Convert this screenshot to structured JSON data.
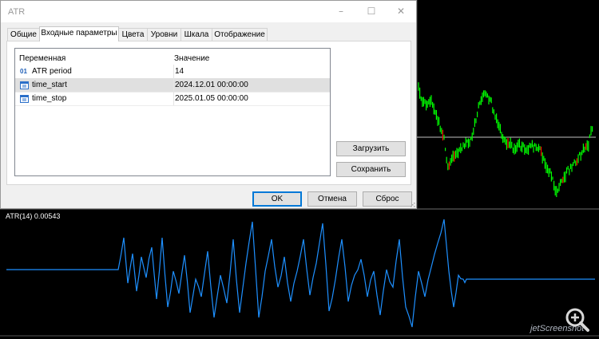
{
  "dialog": {
    "title": "ATR",
    "window_buttons": {
      "minimize": "–",
      "maximize": "☐",
      "close": "✕"
    },
    "tabs": [
      {
        "label": "Общие"
      },
      {
        "label": "Входные параметры",
        "active": true
      },
      {
        "label": "Цвета"
      },
      {
        "label": "Уровни"
      },
      {
        "label": "Шкала"
      },
      {
        "label": "Отображение"
      }
    ],
    "table": {
      "headers": {
        "name": "Переменная",
        "value": "Значение"
      },
      "rows": [
        {
          "icon": "int-param-icon",
          "icon_text": "01",
          "name": "ATR period",
          "value": "14"
        },
        {
          "icon": "calendar-icon",
          "name": "time_start",
          "value": "2024.12.01 00:00:00",
          "selected": true
        },
        {
          "icon": "calendar-icon",
          "name": "time_stop",
          "value": "2025.01.05 00:00:00"
        }
      ]
    },
    "buttons": {
      "load": "Загрузить",
      "save": "Сохранить",
      "ok": "OK",
      "cancel": "Отмена",
      "reset": "Сброс"
    }
  },
  "indicator": {
    "label": "ATR(14) 0.00543",
    "line_color": "#1e90ff"
  },
  "price_chart": {
    "bull_color": "#00ff00",
    "bear_color": "#ff0000",
    "level_line_color": "#c0c0c0"
  },
  "watermark": "jetScreenshot",
  "colors": {
    "chart_background": "#000000",
    "dialog_background": "#f0f0f0",
    "selected_row": "#e0e0e0",
    "default_button_border": "#0078d7"
  }
}
